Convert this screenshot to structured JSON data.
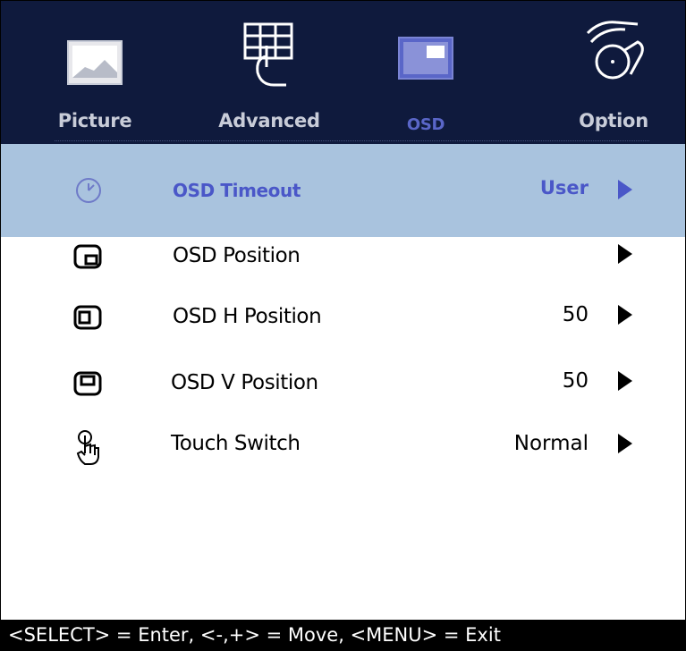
{
  "tabs": [
    {
      "label": "Picture",
      "icon": "picture-icon",
      "active": false
    },
    {
      "label": "Advanced",
      "icon": "grid-touch-icon",
      "active": false
    },
    {
      "label": "OSD",
      "icon": "osd-screen-icon",
      "active": true
    },
    {
      "label": "Option",
      "icon": "hand-dial-icon",
      "active": false
    }
  ],
  "menu": {
    "items": [
      {
        "label": "OSD Timeout",
        "value": "User",
        "icon": "clock-icon",
        "selected": true
      },
      {
        "label": "OSD Position",
        "value": "",
        "icon": "position-icon",
        "selected": false
      },
      {
        "label": "OSD H Position",
        "value": "50",
        "icon": "h-position-icon",
        "selected": false
      },
      {
        "label": "OSD V Position",
        "value": "50",
        "icon": "v-position-icon",
        "selected": false
      },
      {
        "label": "Touch Switch",
        "value": "Normal",
        "icon": "touch-hand-icon",
        "selected": false
      }
    ]
  },
  "footer": {
    "hint": "<SELECT> = Enter, <-,+> = Move, <MENU> = Exit"
  },
  "colors": {
    "header_bg": "#0f1a3d",
    "selected_bg": "#a9c3de",
    "selected_text": "#4a57c8",
    "footer_bg": "#000000"
  }
}
